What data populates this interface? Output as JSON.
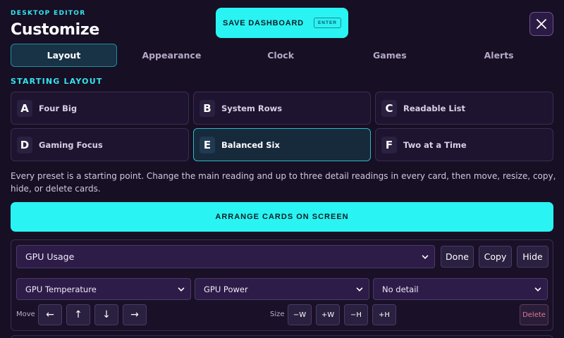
{
  "header": {
    "eyebrow": "DESKTOP EDITOR",
    "title": "Customize",
    "save_label": "SAVE DASHBOARD",
    "save_key": "ENTER",
    "close_icon": "close-icon"
  },
  "tabs": [
    {
      "label": "Layout",
      "active": true
    },
    {
      "label": "Appearance",
      "active": false
    },
    {
      "label": "Clock",
      "active": false
    },
    {
      "label": "Games",
      "active": false
    },
    {
      "label": "Alerts",
      "active": false
    }
  ],
  "starting_layout": {
    "label": "STARTING LAYOUT",
    "presets": [
      {
        "letter": "A",
        "name": "Four Big",
        "active": false
      },
      {
        "letter": "B",
        "name": "System Rows",
        "active": false
      },
      {
        "letter": "C",
        "name": "Readable List",
        "active": false
      },
      {
        "letter": "D",
        "name": "Gaming Focus",
        "active": false
      },
      {
        "letter": "E",
        "name": "Balanced Six",
        "active": true
      },
      {
        "letter": "F",
        "name": "Two at a Time",
        "active": false
      }
    ],
    "info": "Every preset is a starting point. Change the main reading and up to three detail readings in every card, then move, resize, copy, hide, or delete cards."
  },
  "arrange_label": "ARRANGE CARDS ON SCREEN",
  "card": {
    "main_reading": "GPU Usage",
    "done_label": "Done",
    "copy_label": "Copy",
    "hide_label": "Hide",
    "details": [
      "GPU Temperature",
      "GPU Power",
      "No detail"
    ],
    "move_label": "Move",
    "move_buttons": [
      "←",
      "↑",
      "↓",
      "→"
    ],
    "size_label": "Size",
    "size_buttons": [
      "−W",
      "+W",
      "−H",
      "+H"
    ],
    "delete_label": "Delete"
  },
  "colors": {
    "accent": "#2af3f3",
    "background": "#170f24",
    "section_label": "#34e6f0",
    "delete": "#e07a90"
  }
}
